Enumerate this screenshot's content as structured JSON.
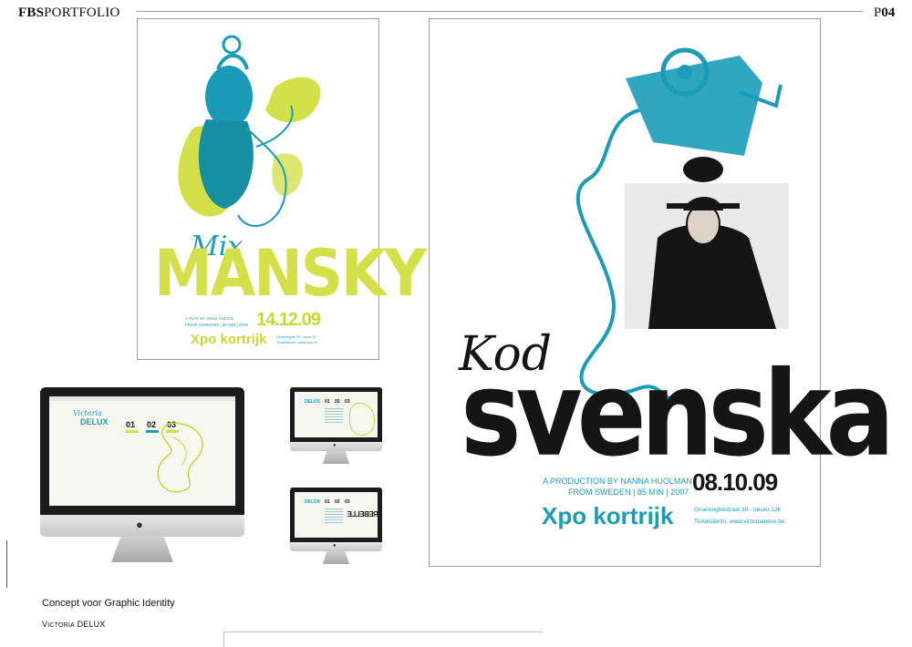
{
  "header": {
    "brand_bold": "FBS",
    "brand_rest": "PORTFOLIO",
    "page_prefix": "P",
    "page_number": "04"
  },
  "poster_mix": {
    "script_title": "Mix",
    "title": "MANSKY",
    "credit_line1": "A PLAY BY ANNA ACEICE",
    "credit_line2": "FROM GERMANY | 90 MIN | 2009",
    "date": "14.12.09",
    "venue": "Xpo kortrijk",
    "info_line1": "Groeninghe 39 - toon 12",
    "info_line2": "Tickets&info: www.vict.be"
  },
  "poster_svenska": {
    "script_title": "Kod",
    "title": "svenska",
    "credit_line1": "A PRODUCTION BY NANNA HUOLMAN",
    "credit_line2": "FROM SWEDEN | 85 MIN | 2007",
    "date": "08.10.09",
    "venue": "Xpo kortrijk",
    "info_line1": "Groeninghestraat 39 - inkom 12€",
    "info_line2": "Tickets&info: www.victoriadelux.be"
  },
  "monitor_large": {
    "logo_script": "Victoria",
    "logo": "DELUX",
    "nav": [
      "01",
      "02",
      "03"
    ]
  },
  "monitor_small_1": {
    "logo": "DELUX",
    "nav": [
      "01",
      "02",
      "03"
    ]
  },
  "monitor_small_2": {
    "logo": "DELUX",
    "nav": [
      "01",
      "02",
      "03"
    ],
    "banner": "REBELLE"
  },
  "caption": {
    "title": "Concept voor Graphic Identity",
    "client_first": "V",
    "client_small": "ictoria",
    "client_rest": " DELUX"
  },
  "colors": {
    "teal": "#1a9cb8",
    "lime": "#d4e04a",
    "black": "#151515"
  }
}
